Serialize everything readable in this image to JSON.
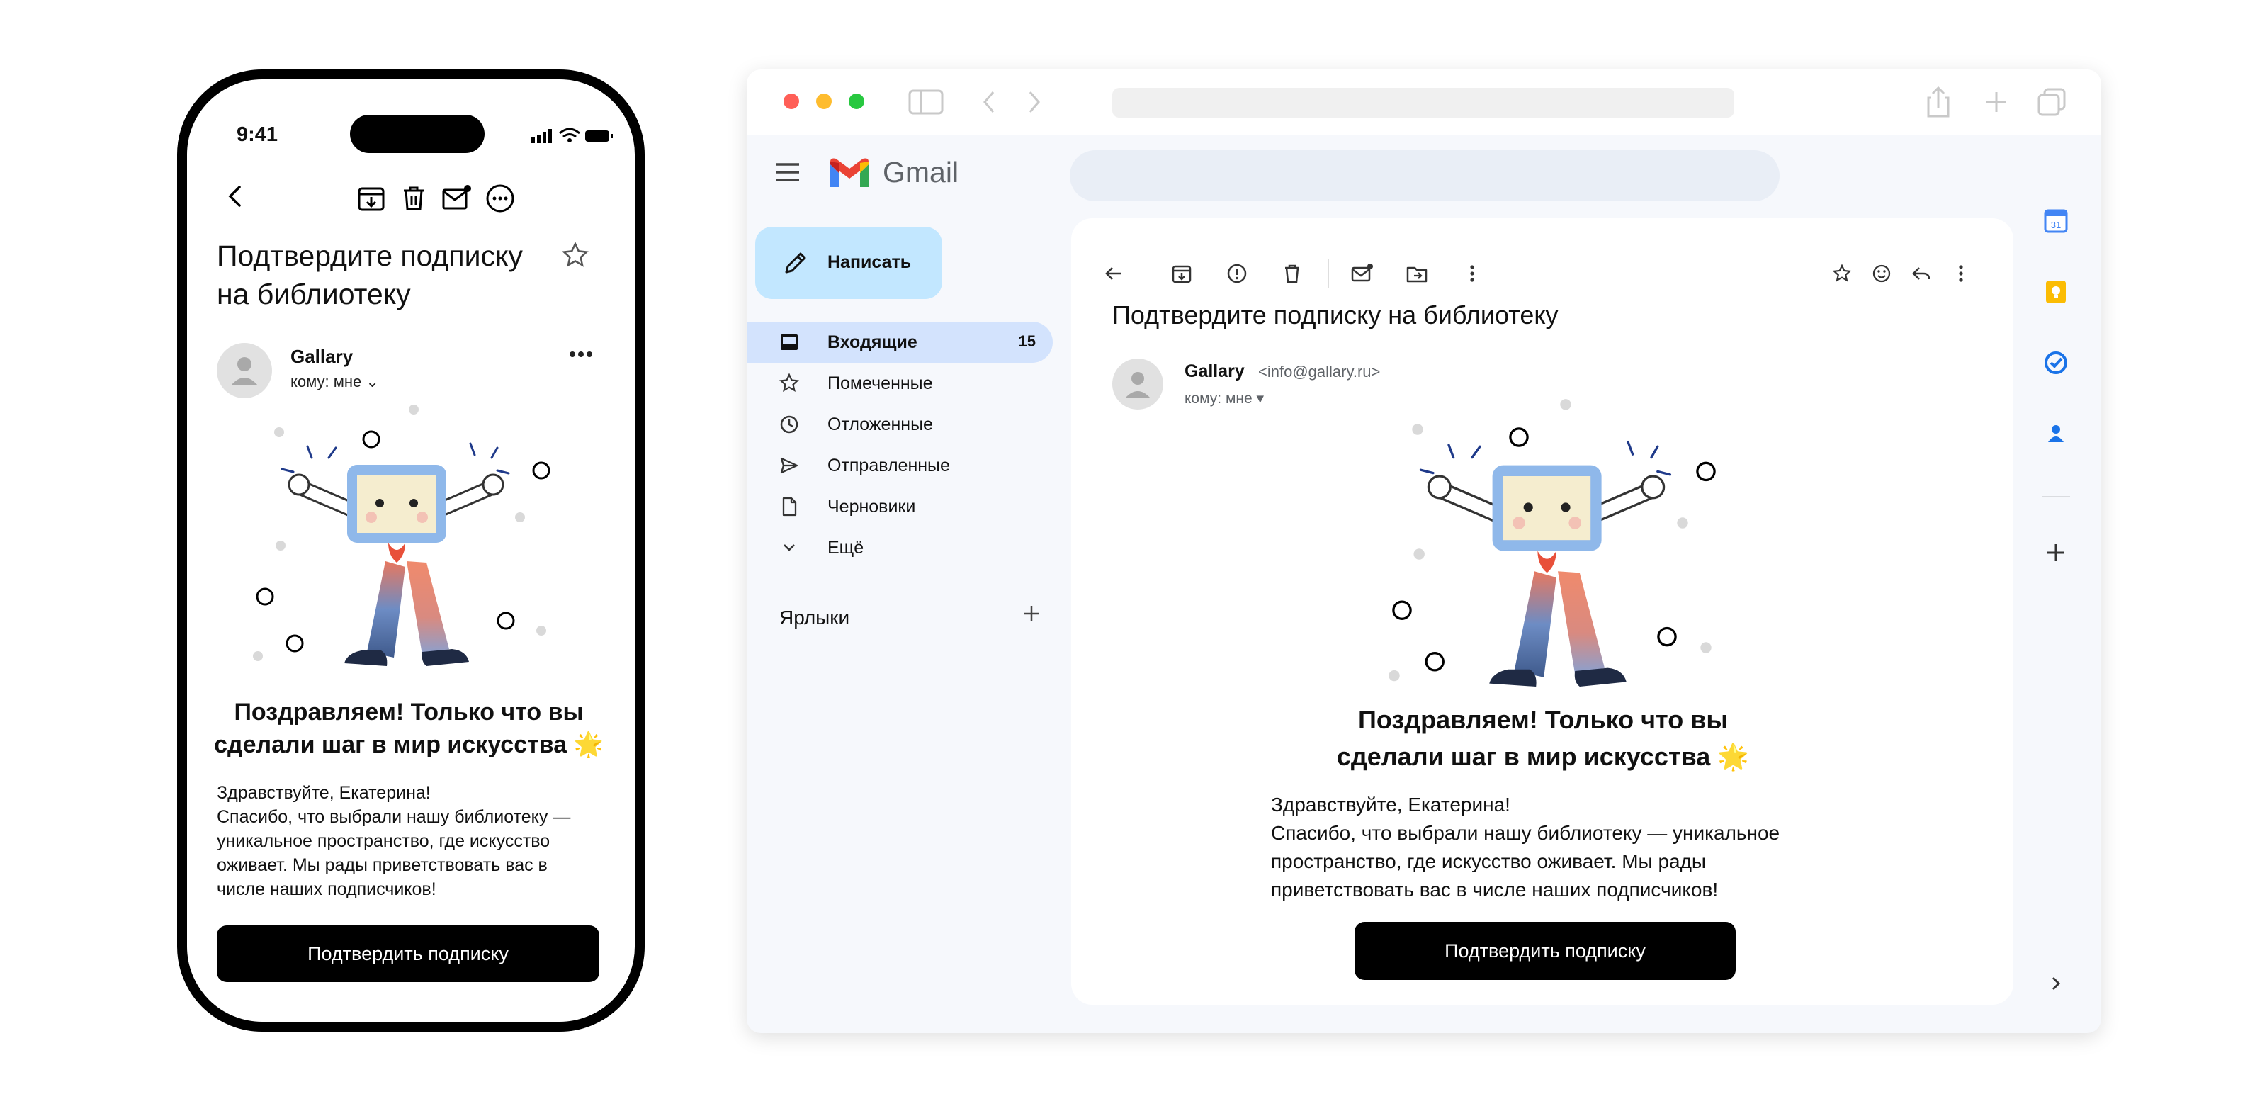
{
  "phone": {
    "time": "9:41",
    "subject": "Подтвердите подписку на библиотеку",
    "sender": "Gallary",
    "to": "кому: мне ⌄",
    "heading": "Поздравляем! Только что вы сделали шаг в мир искусства 🌟",
    "body": "Здравствуйте, Екатерина!\nСпасибо, что выбрали нашу библиотеку — уникальное пространство, где искусство оживает. Мы рады приветствовать вас в числе наших подписчиков!",
    "button": "Подтвердить подписку"
  },
  "browser": {
    "traffic_colors": [
      "#ff5f57",
      "#febc2e",
      "#28c840"
    ],
    "app_name": "Gmail",
    "compose": "Написать",
    "nav": [
      {
        "label": "Входящие",
        "count": "15",
        "icon": "inbox-icon"
      },
      {
        "label": "Помеченные",
        "count": "",
        "icon": "star-icon"
      },
      {
        "label": "Отложенные",
        "count": "",
        "icon": "clock-icon"
      },
      {
        "label": "Отправленные",
        "count": "",
        "icon": "send-icon"
      },
      {
        "label": "Черновики",
        "count": "",
        "icon": "draft-icon"
      },
      {
        "label": "Ещё",
        "count": "",
        "icon": "chevron-down-icon"
      }
    ],
    "labels_title": "Ярлыки",
    "mail": {
      "subject": "Подтвердите подписку на библиотеку",
      "sender": "Gallary",
      "email": "<info@gallary.ru>",
      "to": "кому: мне ▾",
      "heading": "Поздравляем! Только что вы сделали шаг в мир искусства 🌟",
      "body": "Здравствуйте, Екатерина!\nСпасибо, что выбрали нашу библиотеку — уникальное пространство, где искусство оживает. Мы рады приветствовать вас в числе наших подписчиков!",
      "button": "Подтвердить подписку"
    }
  }
}
